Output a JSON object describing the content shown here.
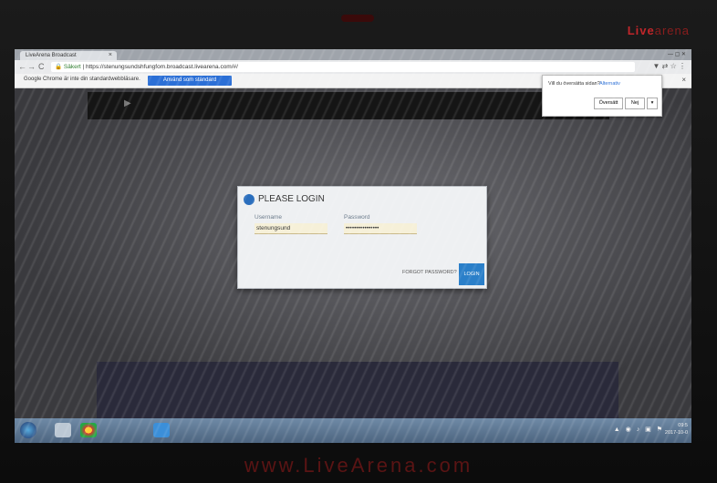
{
  "bezel": {
    "brand_live": "Live",
    "brand_rest": "arena",
    "bottom_text": "www.LiveArena.com"
  },
  "browser": {
    "tab_title": "LiveArena Broadcast",
    "tab_close": "×",
    "address": {
      "security": "Säkert",
      "url": "https://stenungsundshfungfom.broadcast.livearena.com/#/"
    },
    "infobar": {
      "text": "Google Chrome är inte din standardwebbläsare.",
      "button": "Använd som standard",
      "close": "×"
    },
    "translate": {
      "question": "Vill du översätta sidan?",
      "options": "Alternativ",
      "translate_button": "Översätt",
      "no_button": "Nej",
      "more": "▾"
    }
  },
  "login": {
    "title": "PLEASE LOGIN",
    "username_label": "Username",
    "username_value": "stenungsund",
    "password_label": "Password",
    "password_value": "••••••••••••••••",
    "forgot": "FORGOT PASSWORD?",
    "login_button": "LOGIN"
  },
  "taskbar": {
    "clock_time": "09:5",
    "clock_date": "2017-10-0"
  }
}
